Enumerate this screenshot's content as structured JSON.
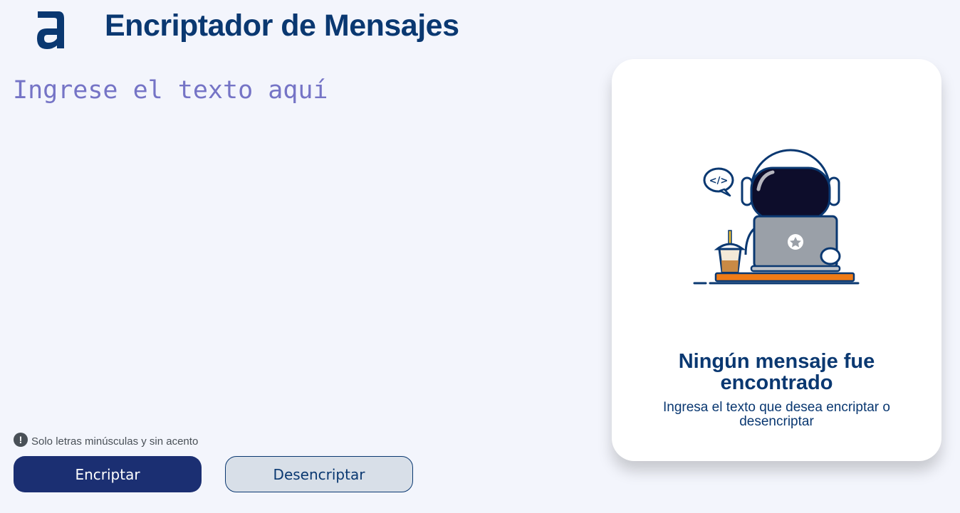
{
  "header": {
    "logo_icon": "alura-a-logo",
    "title": "Encriptador de Mensajes"
  },
  "input": {
    "placeholder": "Ingrese el texto aquí",
    "value": ""
  },
  "hint": {
    "icon": "exclamation-circle-icon",
    "text": "Solo letras minúsculas y sin acento"
  },
  "buttons": {
    "encrypt_label": "Encriptar",
    "decrypt_label": "Desencriptar"
  },
  "output_card": {
    "illustration": "astronaut-with-laptop",
    "speech_bubble_text": "</>",
    "title": "Ningún mensaje fue encontrado",
    "subtitle": "Ingresa el texto que desea encriptar o desencriptar"
  },
  "colors": {
    "background": "#f3f5fc",
    "primary": "#0a3871",
    "button_primary": "#1b2f72",
    "button_secondary": "#d8dfe8",
    "placeholder": "#7574c6"
  }
}
